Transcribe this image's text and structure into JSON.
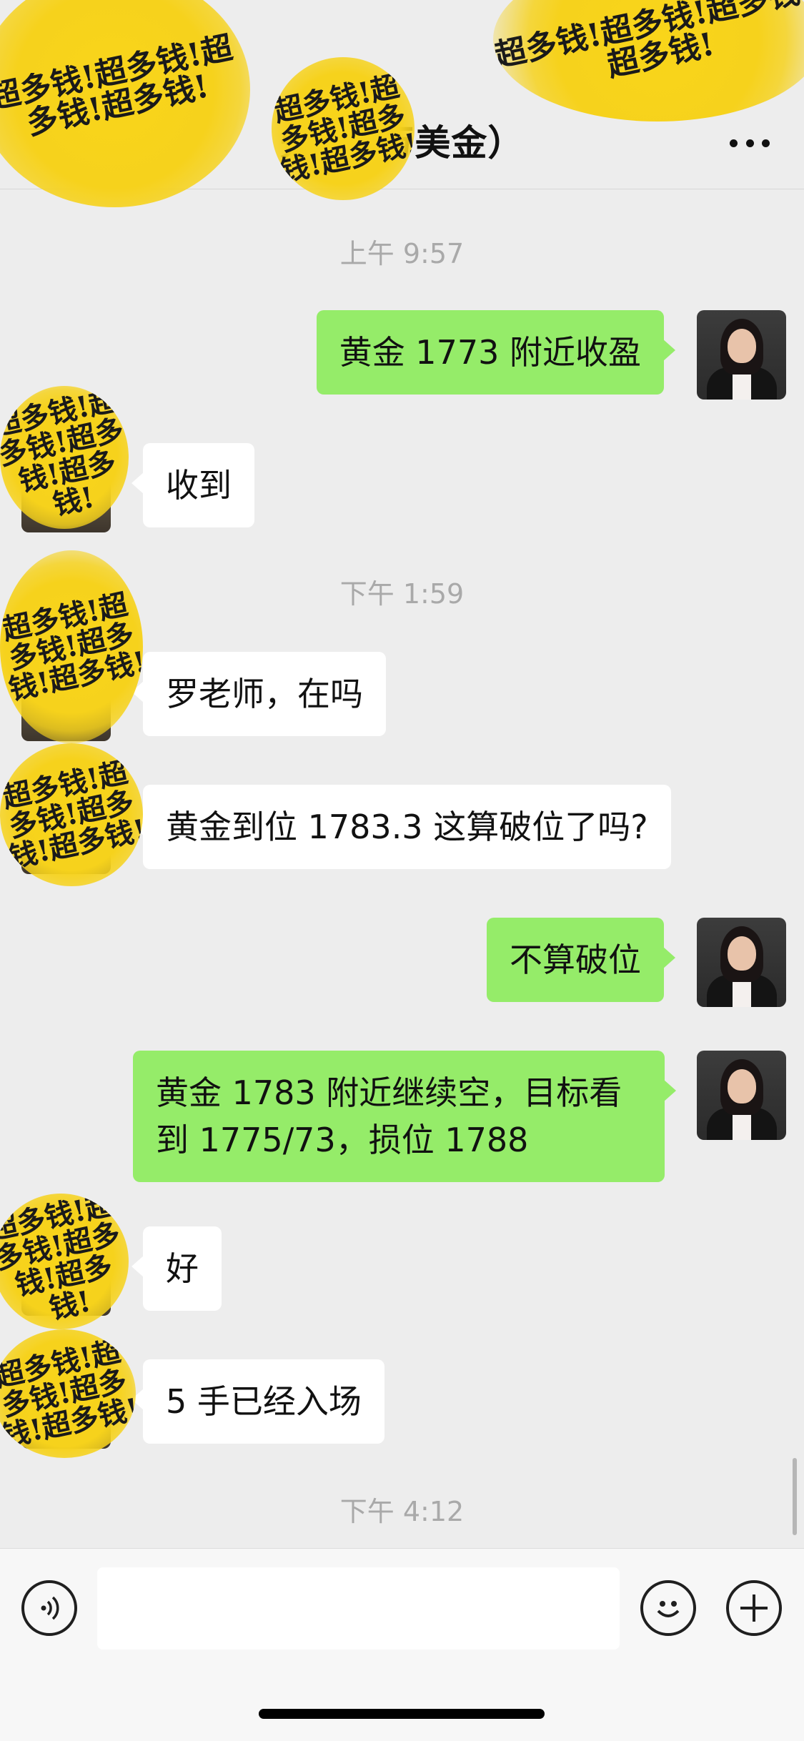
{
  "header": {
    "title": "先（4万美金）",
    "more_icon": "more-horizontal-icon"
  },
  "stickers": {
    "text": "超多钱!超多钱!超多钱!超多钱!",
    "color": "#f6d21c"
  },
  "messages": [
    {
      "type": "time",
      "text": "上午 9:57"
    },
    {
      "type": "out",
      "text": "黄金 1773 附近收盈"
    },
    {
      "type": "in",
      "text": "收到"
    },
    {
      "type": "time",
      "text": "下午 1:59"
    },
    {
      "type": "in",
      "text": "罗老师，在吗"
    },
    {
      "type": "in",
      "text": "黄金到位 1783.3 这算破位了吗?"
    },
    {
      "type": "out",
      "text": "不算破位"
    },
    {
      "type": "out",
      "text": "黄金 1783 附近继续空，目标看到 1775/73，损位 1788"
    },
    {
      "type": "in",
      "text": "好"
    },
    {
      "type": "in",
      "text": "5 手已经入场"
    },
    {
      "type": "time",
      "text": "下午 4:12"
    }
  ],
  "input_bar": {
    "voice_icon": "voice-icon",
    "emoji_icon": "emoji-icon",
    "add_icon": "plus-icon",
    "input_value": ""
  },
  "colors": {
    "background": "#ededed",
    "bubble_out": "#95ec69",
    "bubble_in": "#ffffff",
    "timestamp": "#a9a9a9"
  }
}
